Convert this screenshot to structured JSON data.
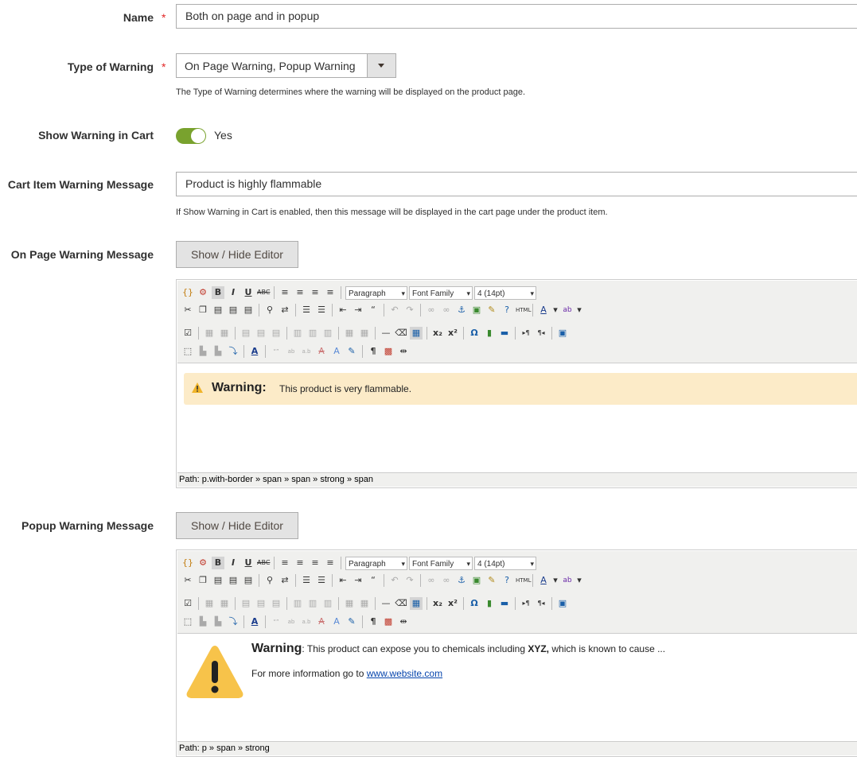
{
  "name_field": {
    "label": "Name",
    "required": "*",
    "value": "Both on page and in popup"
  },
  "type_field": {
    "label": "Type of Warning",
    "required": "*",
    "value": "On Page Warning, Popup Warning",
    "note": "The Type of Warning determines where the warning will be displayed on the product page."
  },
  "cart_toggle": {
    "label": "Show Warning in Cart",
    "state": "Yes",
    "color": "#79a22e"
  },
  "cart_msg": {
    "label": "Cart Item Warning Message",
    "value": "Product is highly flammable",
    "note": "If Show Warning in Cart is enabled, then this message will be displayed in the cart page under the product item."
  },
  "on_page": {
    "label": "On Page Warning Message",
    "button": "Show / Hide Editor",
    "warning_title": "Warning:",
    "warning_text": "This product is very flammable.",
    "path": "Path: p.with-border » span » span » strong » span"
  },
  "popup": {
    "label": "Popup Warning Message",
    "button": "Show / Hide Editor",
    "warning_title": "Warning",
    "warning_text_1": ": This product can expose you to chemicals including ",
    "warning_bold": "XYZ,",
    "warning_text_2": " which is known to cause ...",
    "more_info": "For more information go to ",
    "link": "www.website.com",
    "path": "Path: p » span » strong"
  },
  "toolbar": {
    "format": "Paragraph",
    "font": "Font Family",
    "size": "4 (14pt)"
  },
  "colors": {
    "warning_bg": "#fcebc8",
    "warning_icon": "#f7c34a"
  }
}
